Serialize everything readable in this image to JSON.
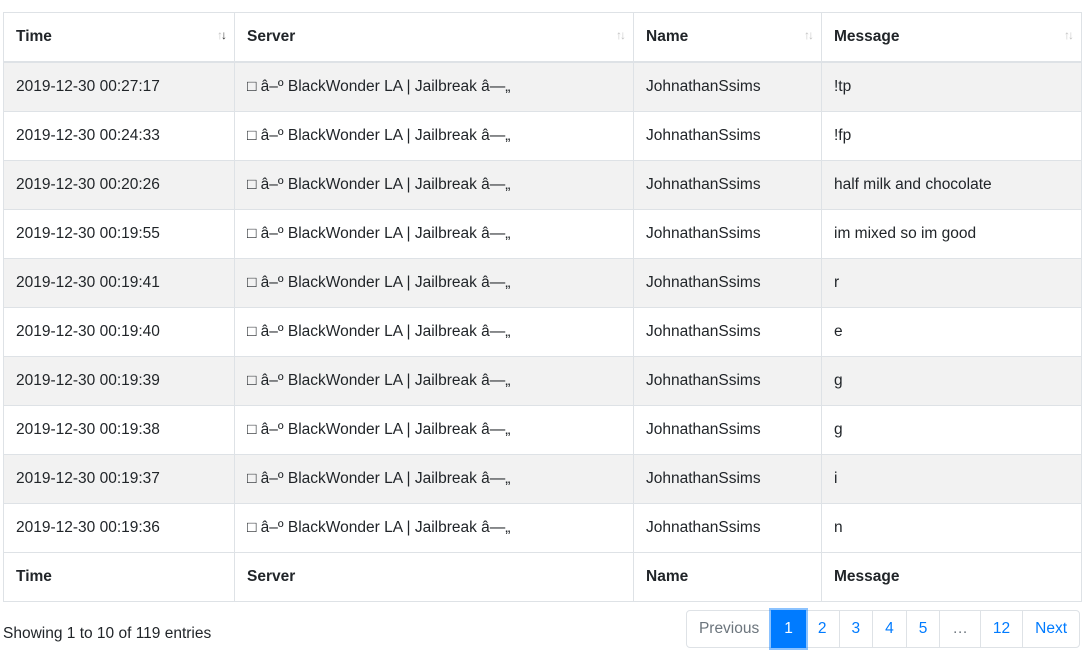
{
  "table": {
    "columns": [
      "Time",
      "Server",
      "Name",
      "Message"
    ],
    "footer_columns": [
      "Time",
      "Server",
      "Name",
      "Message"
    ],
    "rows": [
      {
        "time": "2019-12-30 00:27:17",
        "server": "□ â–º BlackWonder LA | Jailbreak â—„",
        "name": "JohnathanSsims",
        "message": "!tp"
      },
      {
        "time": "2019-12-30 00:24:33",
        "server": "□ â–º BlackWonder LA | Jailbreak â—„",
        "name": "JohnathanSsims",
        "message": "!fp"
      },
      {
        "time": "2019-12-30 00:20:26",
        "server": "□ â–º BlackWonder LA | Jailbreak â—„",
        "name": "JohnathanSsims",
        "message": "half milk and chocolate"
      },
      {
        "time": "2019-12-30 00:19:55",
        "server": "□ â–º BlackWonder LA | Jailbreak â—„",
        "name": "JohnathanSsims",
        "message": "im mixed so im good"
      },
      {
        "time": "2019-12-30 00:19:41",
        "server": "□ â–º BlackWonder LA | Jailbreak â—„",
        "name": "JohnathanSsims",
        "message": "r"
      },
      {
        "time": "2019-12-30 00:19:40",
        "server": "□ â–º BlackWonder LA | Jailbreak â—„",
        "name": "JohnathanSsims",
        "message": "e"
      },
      {
        "time": "2019-12-30 00:19:39",
        "server": "□ â–º BlackWonder LA | Jailbreak â—„",
        "name": "JohnathanSsims",
        "message": "g"
      },
      {
        "time": "2019-12-30 00:19:38",
        "server": "□ â–º BlackWonder LA | Jailbreak â—„",
        "name": "JohnathanSsims",
        "message": "g"
      },
      {
        "time": "2019-12-30 00:19:37",
        "server": "□ â–º BlackWonder LA | Jailbreak â—„",
        "name": "JohnathanSsims",
        "message": "i"
      },
      {
        "time": "2019-12-30 00:19:36",
        "server": "□ â–º BlackWonder LA | Jailbreak â—„",
        "name": "JohnathanSsims",
        "message": "n"
      }
    ],
    "sort_icons": [
      "sort-descending-icon",
      "sort-neutral-icon",
      "sort-neutral-icon",
      "sort-neutral-icon"
    ],
    "sort_glyphs": {
      "up": "↑",
      "down": "↓"
    }
  },
  "info": "Showing 1 to 10 of 119 entries",
  "pagination": {
    "previous": "Previous",
    "pages": [
      "1",
      "2",
      "3",
      "4",
      "5",
      "…",
      "12"
    ],
    "active_page": "1",
    "next": "Next"
  },
  "colors": {
    "accent": "#007bff",
    "stripe": "#f2f2f2",
    "border": "#dee2e6",
    "text": "#212529",
    "muted": "#6c757d"
  }
}
